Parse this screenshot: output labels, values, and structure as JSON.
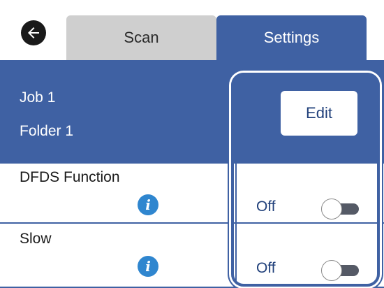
{
  "header": {
    "back_icon": "arrow-left-icon",
    "tabs": [
      {
        "label": "Scan",
        "selected": false
      },
      {
        "label": "Settings",
        "selected": true
      }
    ]
  },
  "job": {
    "line1": "Job 1",
    "line2": "Folder 1",
    "edit_label": "Edit"
  },
  "settings": [
    {
      "label": "DFDS Function",
      "info_icon": "info-icon",
      "value": "Off",
      "toggle_on": false
    },
    {
      "label": "Slow",
      "info_icon": "info-icon",
      "value": "Off",
      "toggle_on": false
    }
  ],
  "colors": {
    "accent": "#3f61a3",
    "tab_inactive": "#cfcfcf",
    "info": "#2f86cf"
  }
}
